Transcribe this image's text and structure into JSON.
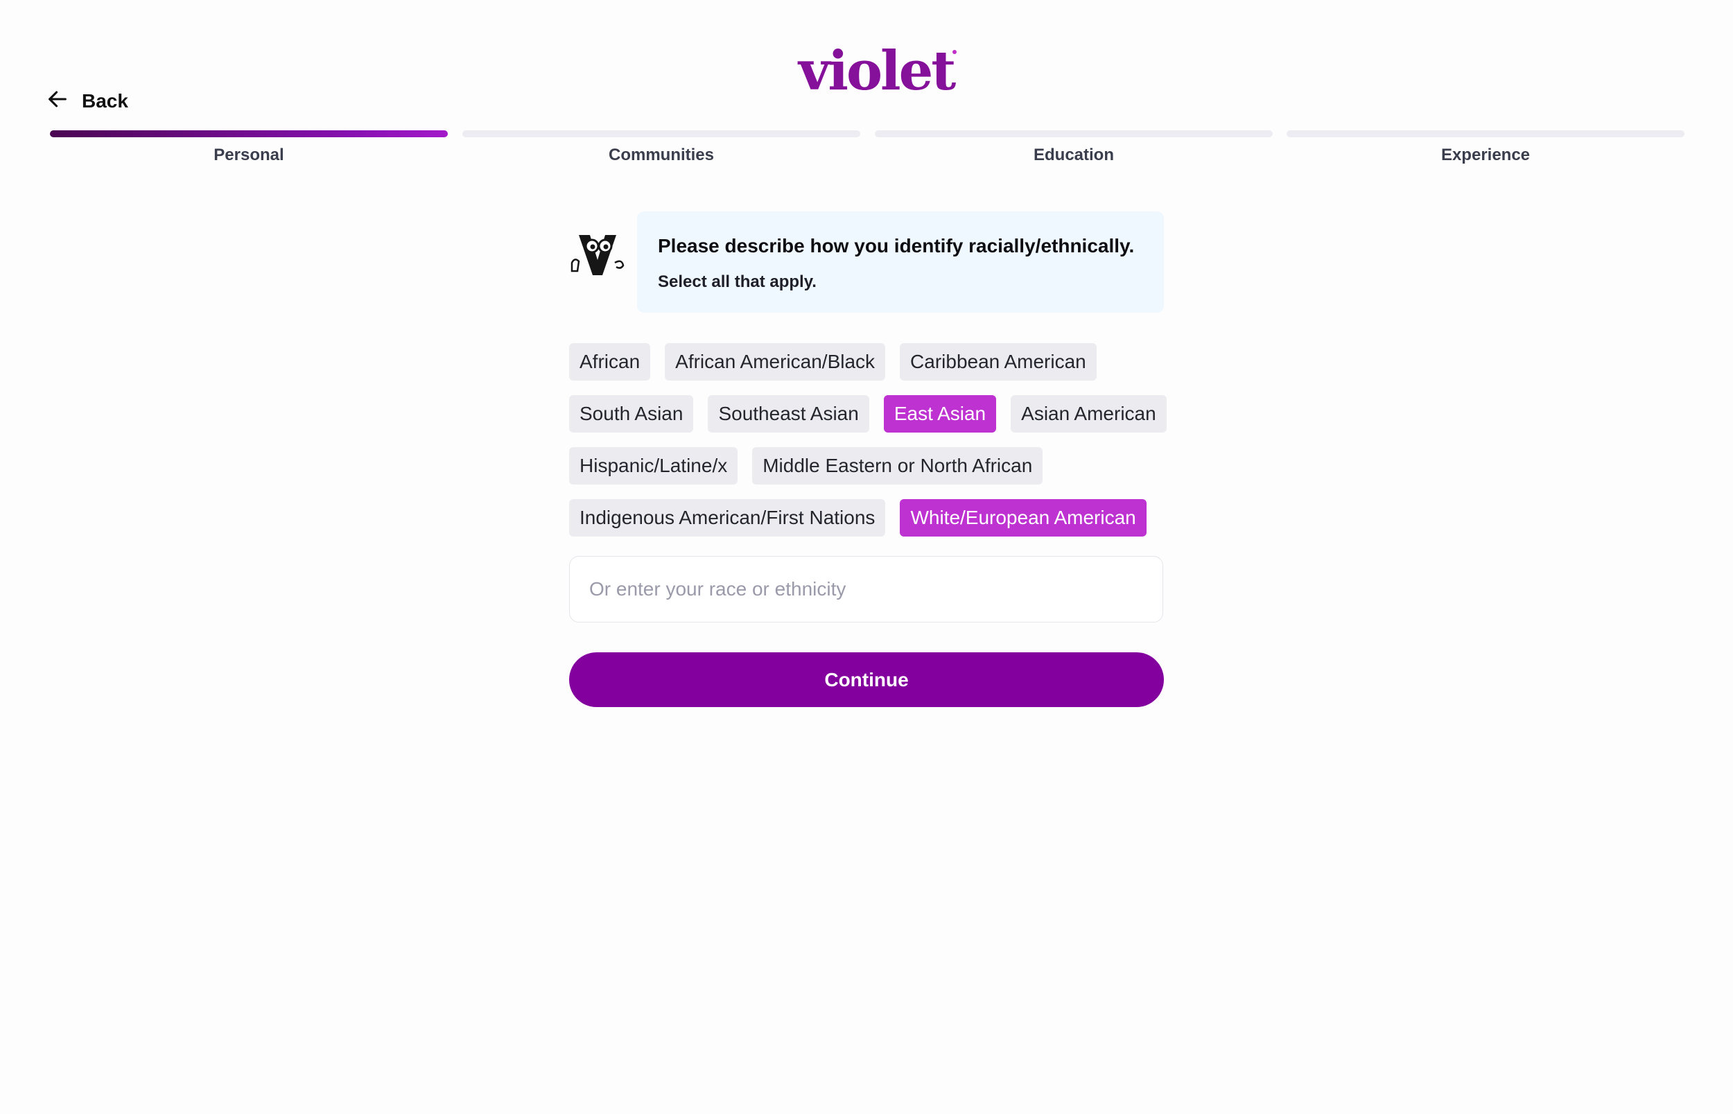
{
  "brand": {
    "logo_text": "violet",
    "primary_color": "#83009f",
    "selected_color": "#bd32d0"
  },
  "nav": {
    "back_label": "Back",
    "back_icon": "arrow-left-icon"
  },
  "progress": {
    "steps": [
      {
        "label": "Personal",
        "active": true
      },
      {
        "label": "Communities",
        "active": false
      },
      {
        "label": "Education",
        "active": false
      },
      {
        "label": "Experience",
        "active": false
      }
    ]
  },
  "prompt": {
    "question": "Please describe how you identify racially/ethnically.",
    "hint": "Select all that apply.",
    "mascot_icon": "violet-mascot-icon"
  },
  "options": {
    "rows": [
      [
        {
          "label": "African",
          "selected": false
        },
        {
          "label": "African American/Black",
          "selected": false
        },
        {
          "label": "Caribbean American",
          "selected": false
        }
      ],
      [
        {
          "label": "South Asian",
          "selected": false
        },
        {
          "label": "Southeast Asian",
          "selected": false
        },
        {
          "label": "East Asian",
          "selected": true
        },
        {
          "label": "Asian American",
          "selected": false
        }
      ],
      [
        {
          "label": "Hispanic/Latine/x",
          "selected": false
        },
        {
          "label": "Middle Eastern or North African",
          "selected": false
        }
      ],
      [
        {
          "label": "Indigenous American/First Nations",
          "selected": false
        },
        {
          "label": "White/European American",
          "selected": true
        }
      ]
    ]
  },
  "other_input": {
    "placeholder": "Or enter your race or ethnicity",
    "value": ""
  },
  "actions": {
    "continue_label": "Continue"
  }
}
